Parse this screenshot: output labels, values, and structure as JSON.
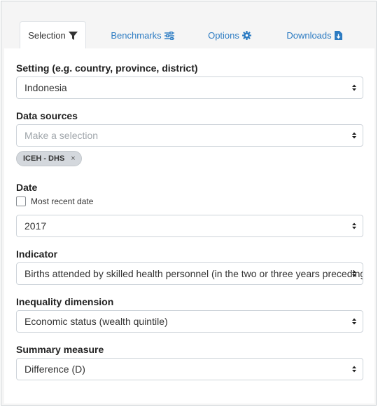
{
  "tabs": [
    {
      "label": "Selection",
      "icon": "filter-icon",
      "active": true
    },
    {
      "label": "Benchmarks",
      "icon": "sliders-icon",
      "active": false
    },
    {
      "label": "Options",
      "icon": "gear-icon",
      "active": false
    },
    {
      "label": "Downloads",
      "icon": "file-download-icon",
      "active": false
    }
  ],
  "colors": {
    "link": "#2c7bc2",
    "chip_bg": "#d4d8dd"
  },
  "setting": {
    "label": "Setting (e.g. country, province, district)",
    "value": "Indonesia"
  },
  "data_sources": {
    "label": "Data sources",
    "placeholder": "Make a selection",
    "chips": [
      "ICEH - DHS"
    ]
  },
  "date": {
    "label": "Date",
    "checkbox_label": "Most recent date",
    "checked": false,
    "value": "2017"
  },
  "indicator": {
    "label": "Indicator",
    "value": "Births attended by skilled health personnel (in the two or three years preceding the survey) (%)"
  },
  "inequality": {
    "label": "Inequality dimension",
    "value": "Economic status (wealth quintile)"
  },
  "summary": {
    "label": "Summary measure",
    "value": "Difference (D)"
  },
  "chip_remove_glyph": "×"
}
